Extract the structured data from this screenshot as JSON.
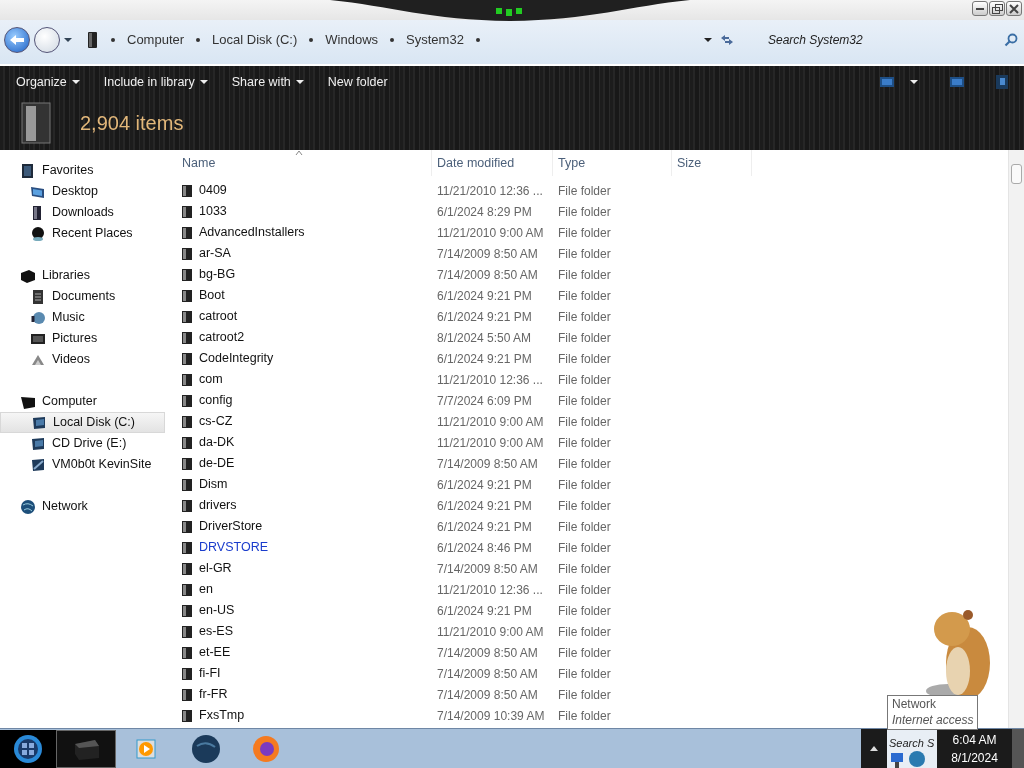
{
  "address_bar": {
    "breadcrumbs": [
      "Computer",
      "Local Disk (C:)",
      "Windows",
      "System32"
    ],
    "search": {
      "placeholder": "Search System32"
    }
  },
  "toolbar": {
    "commands": [
      {
        "label": "Organize",
        "dropdown": true
      },
      {
        "label": "Include in library",
        "dropdown": true
      },
      {
        "label": "Share with",
        "dropdown": true
      },
      {
        "label": "New folder",
        "dropdown": false
      }
    ],
    "item_count": "2,904 items"
  },
  "sidebar": {
    "groups": [
      {
        "label": "Favorites",
        "selected": false,
        "children": [
          {
            "label": "Desktop",
            "selected": false
          },
          {
            "label": "Downloads",
            "selected": false
          },
          {
            "label": "Recent Places",
            "selected": false
          }
        ]
      },
      {
        "label": "Libraries",
        "selected": false,
        "children": [
          {
            "label": "Documents",
            "selected": false
          },
          {
            "label": "Music",
            "selected": false
          },
          {
            "label": "Pictures",
            "selected": false
          },
          {
            "label": "Videos",
            "selected": false
          }
        ]
      },
      {
        "label": "Computer",
        "selected": false,
        "children": [
          {
            "label": "Local Disk (C:)",
            "selected": true
          },
          {
            "label": "CD Drive (E:)",
            "selected": false
          },
          {
            "label": "VM0b0t KevinSite",
            "selected": false
          }
        ]
      },
      {
        "label": "Network",
        "selected": false
      }
    ]
  },
  "table": {
    "columns": [
      "Name",
      "Date modified",
      "Type",
      "Size"
    ],
    "rows": [
      {
        "name": "0409",
        "date": "11/21/2010 12:36 ...",
        "type": "File folder",
        "compressed": false
      },
      {
        "name": "1033",
        "date": "6/1/2024 8:29 PM",
        "type": "File folder",
        "compressed": false
      },
      {
        "name": "AdvancedInstallers",
        "date": "11/21/2010 9:00 AM",
        "type": "File folder",
        "compressed": false
      },
      {
        "name": "ar-SA",
        "date": "7/14/2009 8:50 AM",
        "type": "File folder",
        "compressed": false
      },
      {
        "name": "bg-BG",
        "date": "7/14/2009 8:50 AM",
        "type": "File folder",
        "compressed": false
      },
      {
        "name": "Boot",
        "date": "6/1/2024 9:21 PM",
        "type": "File folder",
        "compressed": false
      },
      {
        "name": "catroot",
        "date": "6/1/2024 9:21 PM",
        "type": "File folder",
        "compressed": false
      },
      {
        "name": "catroot2",
        "date": "8/1/2024 5:50 AM",
        "type": "File folder",
        "compressed": false
      },
      {
        "name": "CodeIntegrity",
        "date": "6/1/2024 9:21 PM",
        "type": "File folder",
        "compressed": false
      },
      {
        "name": "com",
        "date": "11/21/2010 12:36 ...",
        "type": "File folder",
        "compressed": false
      },
      {
        "name": "config",
        "date": "7/7/2024 6:09 PM",
        "type": "File folder",
        "compressed": false
      },
      {
        "name": "cs-CZ",
        "date": "11/21/2010 9:00 AM",
        "type": "File folder",
        "compressed": false
      },
      {
        "name": "da-DK",
        "date": "11/21/2010 9:00 AM",
        "type": "File folder",
        "compressed": false
      },
      {
        "name": "de-DE",
        "date": "7/14/2009 8:50 AM",
        "type": "File folder",
        "compressed": false
      },
      {
        "name": "Dism",
        "date": "6/1/2024 9:21 PM",
        "type": "File folder",
        "compressed": false
      },
      {
        "name": "drivers",
        "date": "6/1/2024 9:21 PM",
        "type": "File folder",
        "compressed": false
      },
      {
        "name": "DriverStore",
        "date": "6/1/2024 9:21 PM",
        "type": "File folder",
        "compressed": false
      },
      {
        "name": "DRVSTORE",
        "date": "6/1/2024 8:46 PM",
        "type": "File folder",
        "compressed": true
      },
      {
        "name": "el-GR",
        "date": "7/14/2009 8:50 AM",
        "type": "File folder",
        "compressed": false
      },
      {
        "name": "en",
        "date": "11/21/2010 12:36 ...",
        "type": "File folder",
        "compressed": false
      },
      {
        "name": "en-US",
        "date": "6/1/2024 9:21 PM",
        "type": "File folder",
        "compressed": false
      },
      {
        "name": "es-ES",
        "date": "11/21/2010 9:00 AM",
        "type": "File folder",
        "compressed": false
      },
      {
        "name": "et-EE",
        "date": "7/14/2009 8:50 AM",
        "type": "File folder",
        "compressed": false
      },
      {
        "name": "fi-FI",
        "date": "7/14/2009 8:50 AM",
        "type": "File folder",
        "compressed": false
      },
      {
        "name": "fr-FR",
        "date": "7/14/2009 8:50 AM",
        "type": "File folder",
        "compressed": false
      },
      {
        "name": "FxsTmp",
        "date": "7/14/2009 10:39 AM",
        "type": "File folder",
        "compressed": false
      }
    ]
  },
  "taskbar": {
    "apps": [
      {
        "selected": true
      },
      {
        "selected": false
      },
      {
        "selected": false
      },
      {
        "selected": false
      }
    ],
    "tray_text": "Search S",
    "time": "6:04 AM",
    "date": "8/1/2024"
  },
  "tooltip": {
    "title": "Network",
    "subtitle": "Internet access"
  }
}
